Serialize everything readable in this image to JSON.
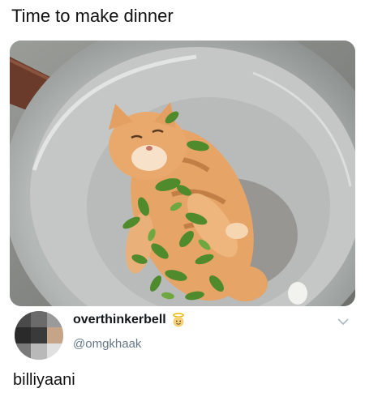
{
  "post": {
    "title": "Time to make dinner"
  },
  "photo": {
    "subject": "cat-in-wok-with-leaves",
    "colors": {
      "pan": "#b9bdbd",
      "cat": "#e8a86a",
      "leaves": "#4f8a2c"
    }
  },
  "reply": {
    "display_name": "overthinkerbell",
    "badge_icon": "baby-angel-emoji",
    "handle": "@omgkhaak",
    "text": "billiyaani",
    "menu_icon": "chevron-down-icon"
  }
}
